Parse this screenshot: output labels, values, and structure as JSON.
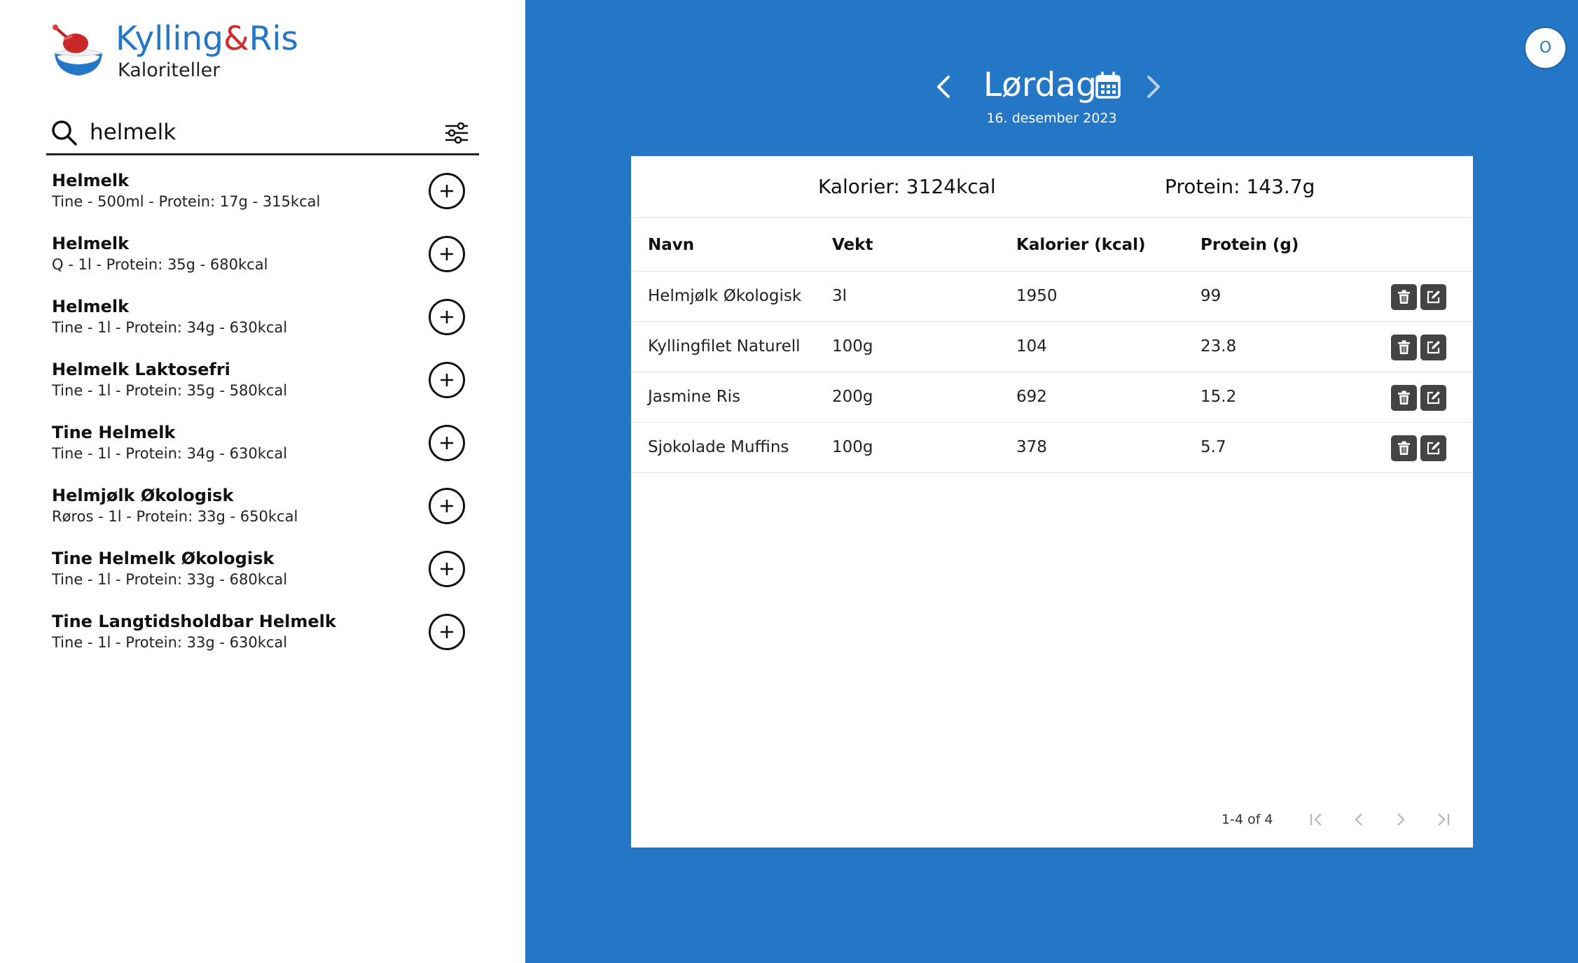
{
  "brand": {
    "name_part1": "Kylling",
    "name_amp": "&",
    "name_part2": "Ris",
    "subtitle": "Kaloriteller",
    "logo_icon": "chicken-rice-bowl-logo"
  },
  "search": {
    "value": "helmelk",
    "icon": "search-icon",
    "filter_icon": "sliders-icon"
  },
  "results": [
    {
      "name": "Helmelk",
      "meta": "Tine - 500ml - Protein: 17g - 315kcal"
    },
    {
      "name": "Helmelk",
      "meta": "Q - 1l - Protein: 35g - 680kcal"
    },
    {
      "name": "Helmelk",
      "meta": "Tine - 1l - Protein: 34g - 630kcal"
    },
    {
      "name": "Helmelk Laktosefri",
      "meta": "Tine - 1l - Protein: 35g - 580kcal"
    },
    {
      "name": "Tine Helmelk",
      "meta": "Tine - 1l - Protein: 34g - 630kcal"
    },
    {
      "name": "Helmjølk Økologisk",
      "meta": "Røros - 1l - Protein: 33g - 650kcal"
    },
    {
      "name": "Tine Helmelk Økologisk",
      "meta": "Tine - 1l - Protein: 33g - 680kcal"
    },
    {
      "name": "Tine Langtidsholdbar Helmelk",
      "meta": "Tine - 1l - Protein: 33g - 630kcal"
    }
  ],
  "user": {
    "avatar_initial": "O"
  },
  "day": {
    "title": "Lørdag",
    "date": "16. desember 2023"
  },
  "totals": {
    "calories": "Kalorier: 3124kcal",
    "protein": "Protein: 143.7g"
  },
  "table": {
    "headers": [
      "Navn",
      "Vekt",
      "Kalorier (kcal)",
      "Protein (g)"
    ],
    "rows": [
      [
        "Helmjølk Økologisk",
        "3l",
        "1950",
        "99"
      ],
      [
        "Kyllingfilet Naturell",
        "100g",
        "104",
        "23.8"
      ],
      [
        "Jasmine Ris",
        "200g",
        "692",
        "15.2"
      ],
      [
        "Sjokolade Muffins",
        "100g",
        "378",
        "5.7"
      ]
    ]
  },
  "pagination": {
    "info": "1-4 of 4"
  },
  "colors": {
    "main_background": "#2476c6",
    "brand_accent": "#d12b2b",
    "action_button": "#444444"
  }
}
